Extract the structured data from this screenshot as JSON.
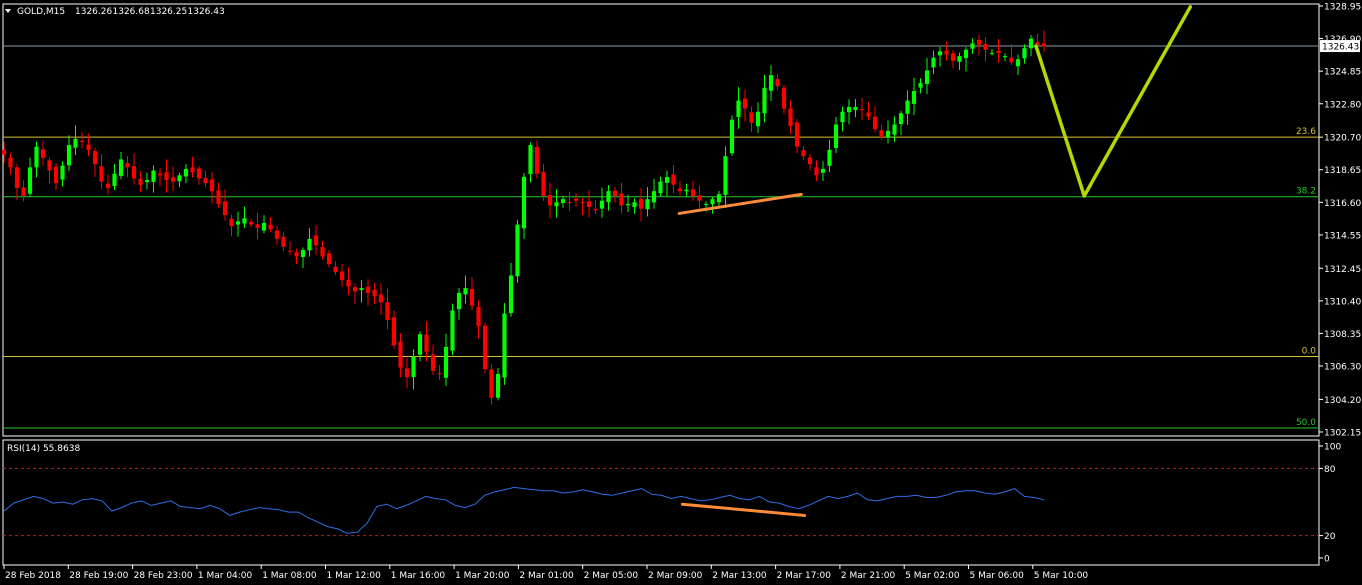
{
  "chart_data": {
    "type": "candlestick",
    "title": "GOLD,M15",
    "ohlc_header": [
      "1326.26",
      "1326.68",
      "1326.25",
      "1326.43"
    ],
    "current_price": 1326.43,
    "current_price_label": "1326.43",
    "ylim": [
      1302.15,
      1328.95
    ],
    "price_ticks": [
      "1328.95",
      "1326.90",
      "1324.85",
      "1322.80",
      "1320.70",
      "1318.65",
      "1316.60",
      "1314.55",
      "1312.45",
      "1310.40",
      "1308.35",
      "1306.30",
      "1304.20",
      "1302.15"
    ],
    "time_ticks": [
      "28 Feb 2018",
      "28 Feb 19:00",
      "28 Feb 23:00",
      "1 Mar 04:00",
      "1 Mar 08:00",
      "1 Mar 12:00",
      "1 Mar 16:00",
      "1 Mar 20:00",
      "2 Mar 01:00",
      "2 Mar 05:00",
      "2 Mar 09:00",
      "2 Mar 13:00",
      "2 Mar 17:00",
      "2 Mar 21:00",
      "5 Mar 02:00",
      "5 Mar 06:00",
      "5 Mar 10:00"
    ],
    "fib_levels": [
      {
        "label": "23.6",
        "price": 1320.7,
        "color": "#d8c030"
      },
      {
        "label": "38.2",
        "price": 1316.95,
        "color": "#28c828"
      },
      {
        "label": "0.0",
        "price": 1306.9,
        "color": "#d8c030"
      },
      {
        "label": "50.0",
        "price": 1302.4,
        "color": "#28c828"
      }
    ],
    "price_path": [
      1319.6,
      1318.8,
      1317.5,
      1317.0,
      1318.8,
      1320.1,
      1319.4,
      1318.6,
      1317.8,
      1318.9,
      1320.2,
      1320.6,
      1320.4,
      1319.9,
      1319.0,
      1317.9,
      1317.5,
      1318.4,
      1319.3,
      1318.8,
      1318.1,
      1317.7,
      1318.0,
      1318.6,
      1318.3,
      1318.0,
      1317.9,
      1318.3,
      1318.7,
      1318.5,
      1318.1,
      1317.8,
      1317.3,
      1316.5,
      1315.8,
      1315.1,
      1315.4,
      1315.6,
      1315.2,
      1315.0,
      1315.3,
      1314.9,
      1314.3,
      1313.8,
      1313.5,
      1313.2,
      1313.6,
      1314.3,
      1313.9,
      1313.2,
      1312.7,
      1312.2,
      1311.7,
      1311.3,
      1311.0,
      1311.2,
      1310.9,
      1310.7,
      1310.3,
      1309.2,
      1307.6,
      1306.2,
      1305.6,
      1306.9,
      1308.3,
      1307.2,
      1306.0,
      1305.8,
      1307.5,
      1309.8,
      1310.9,
      1311.2,
      1310.1,
      1308.8,
      1306.1,
      1304.3,
      1305.8,
      1309.6,
      1312.0,
      1315.2,
      1318.2,
      1320.2,
      1318.4,
      1317.0,
      1316.4,
      1316.6,
      1316.8,
      1316.6,
      1316.7,
      1316.6,
      1316.3,
      1316.1,
      1316.7,
      1317.3,
      1317.0,
      1316.4,
      1316.5,
      1316.6,
      1316.2,
      1316.8,
      1317.3,
      1317.9,
      1318.2,
      1317.7,
      1317.3,
      1317.4,
      1317.0,
      1316.7,
      1316.5,
      1316.8,
      1317.1,
      1319.5,
      1321.8,
      1323.0,
      1322.5,
      1321.6,
      1322.3,
      1323.8,
      1324.6,
      1323.9,
      1322.5,
      1321.4,
      1320.1,
      1319.5,
      1319.0,
      1318.3,
      1318.7,
      1319.9,
      1321.5,
      1322.3,
      1322.6,
      1322.6,
      1322.4,
      1322.0,
      1321.2,
      1320.7,
      1321.1,
      1321.5,
      1322.2,
      1323.0,
      1323.6,
      1324.1,
      1324.9,
      1325.7,
      1326.1,
      1325.9,
      1325.5,
      1325.8,
      1326.2,
      1326.6,
      1326.5,
      1326.2,
      1326.0,
      1326.0,
      1325.8,
      1325.4,
      1325.6,
      1326.3,
      1326.9,
      1326.5,
      1326.4
    ],
    "annotations": {
      "price_divergence": [
        [
          10.5,
          1315.9
        ],
        [
          12.4,
          1317.1
        ]
      ],
      "forecast_path": [
        [
          16.05,
          1326.43
        ],
        [
          16.8,
          1317.0
        ],
        [
          18.45,
          1328.9
        ]
      ]
    },
    "rsi": {
      "label": "RSI(14) 55.8638",
      "ticks": [
        "100",
        "80",
        "20",
        "0"
      ],
      "levels": [
        80,
        20
      ],
      "ylim": [
        0,
        100
      ],
      "values": [
        42,
        49,
        52,
        55,
        53,
        49,
        50,
        48,
        52,
        53,
        51,
        42,
        45,
        49,
        51,
        47,
        49,
        51,
        46,
        45,
        44,
        47,
        44,
        38,
        41,
        43,
        45,
        44,
        43,
        41,
        41,
        36,
        32,
        28,
        26,
        22,
        23,
        31,
        46,
        48,
        44,
        47,
        51,
        55,
        53,
        52,
        47,
        45,
        48,
        56,
        59,
        61,
        63,
        62,
        61,
        60,
        60,
        58,
        59,
        61,
        59,
        57,
        56,
        58,
        60,
        62,
        57,
        56,
        53,
        55,
        53,
        51,
        52,
        54,
        56,
        53,
        52,
        55,
        50,
        49,
        46,
        44,
        47,
        51,
        55,
        53,
        55,
        58,
        52,
        51,
        53,
        55,
        55,
        56,
        54,
        54,
        56,
        59,
        60,
        60,
        58,
        57,
        59,
        62,
        55,
        54,
        52
      ],
      "divergence": [
        [
          10.55,
          48
        ],
        [
          12.45,
          38
        ]
      ]
    }
  }
}
